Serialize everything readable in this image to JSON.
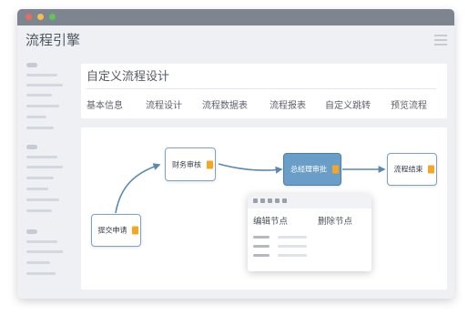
{
  "app": {
    "title": "流程引擎"
  },
  "page": {
    "title": "自定义流程设计"
  },
  "tabs": [
    {
      "label": "基本信息"
    },
    {
      "label": "流程设计"
    },
    {
      "label": "流程数据表"
    },
    {
      "label": "流程报表"
    },
    {
      "label": "自定义跳转"
    },
    {
      "label": "预览流程"
    }
  ],
  "flow": {
    "nodes": [
      {
        "label": "提交申请"
      },
      {
        "label": "财务审核"
      },
      {
        "label": "总经理审批",
        "selected": true
      },
      {
        "label": "流程结束"
      }
    ]
  },
  "context_menu": {
    "actions": [
      {
        "label": "编辑节点"
      },
      {
        "label": "删除节点"
      }
    ]
  },
  "colors": {
    "accent": "#6a9dc7",
    "node_border": "#7ea3c2",
    "handle": "#f5a623",
    "edge": "#5a88b0"
  }
}
